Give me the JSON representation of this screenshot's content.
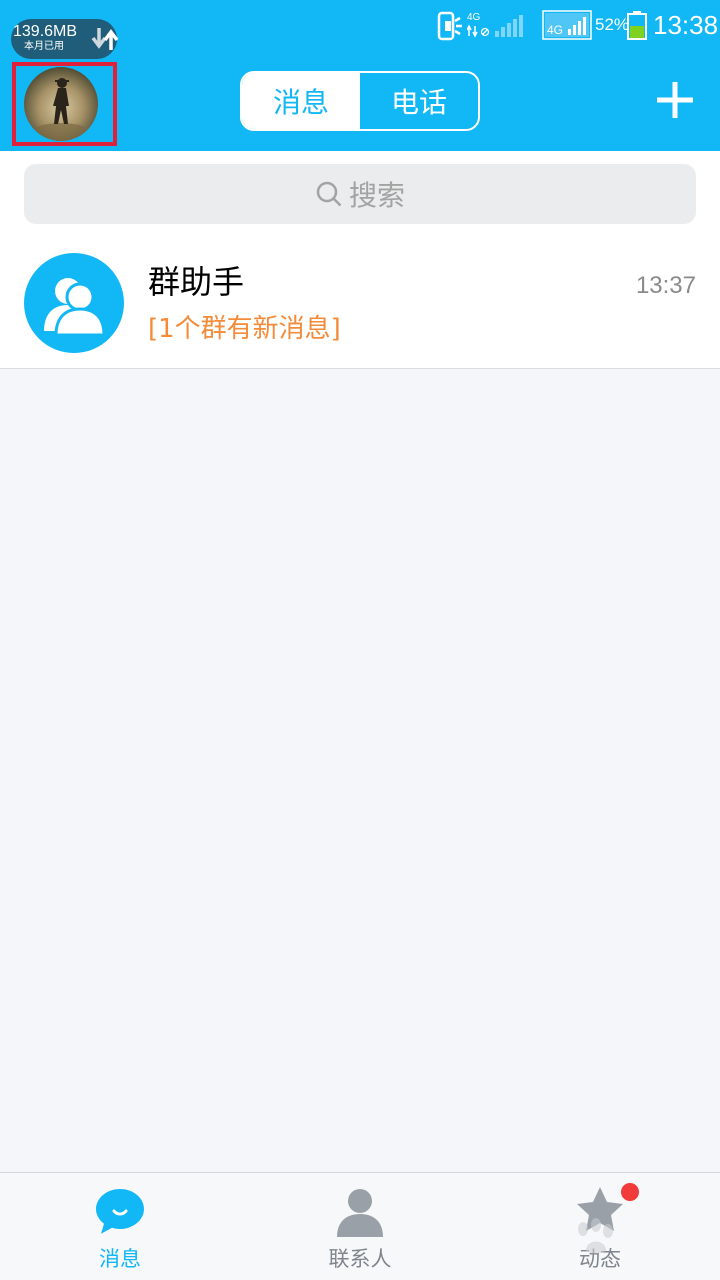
{
  "status_bar": {
    "data_usage_amount": "139.6MB",
    "data_usage_label": "本月已用",
    "network_small": "4G",
    "network_box": "4G",
    "battery_percent": "52%",
    "battery_level": 0.52,
    "time": "13:38"
  },
  "header": {
    "tabs": [
      {
        "label": "消息",
        "active": true
      },
      {
        "label": "电话",
        "active": false
      }
    ]
  },
  "search": {
    "placeholder": "搜索"
  },
  "conversations": [
    {
      "title": "群助手",
      "time": "13:37",
      "preview": "[1个群有新消息]",
      "icon": "group-assistant-icon"
    }
  ],
  "tabbar": {
    "items": [
      {
        "label": "消息",
        "icon": "message-bubble-icon",
        "active": true
      },
      {
        "label": "联系人",
        "icon": "contacts-person-icon",
        "active": false
      },
      {
        "label": "动态",
        "icon": "star-activity-icon",
        "active": false,
        "badge": true
      }
    ]
  },
  "colors": {
    "brand": "#12b7f5",
    "preview_text": "#f48b39",
    "badge": "#f23b3b",
    "highlight_border": "#e0203a"
  }
}
